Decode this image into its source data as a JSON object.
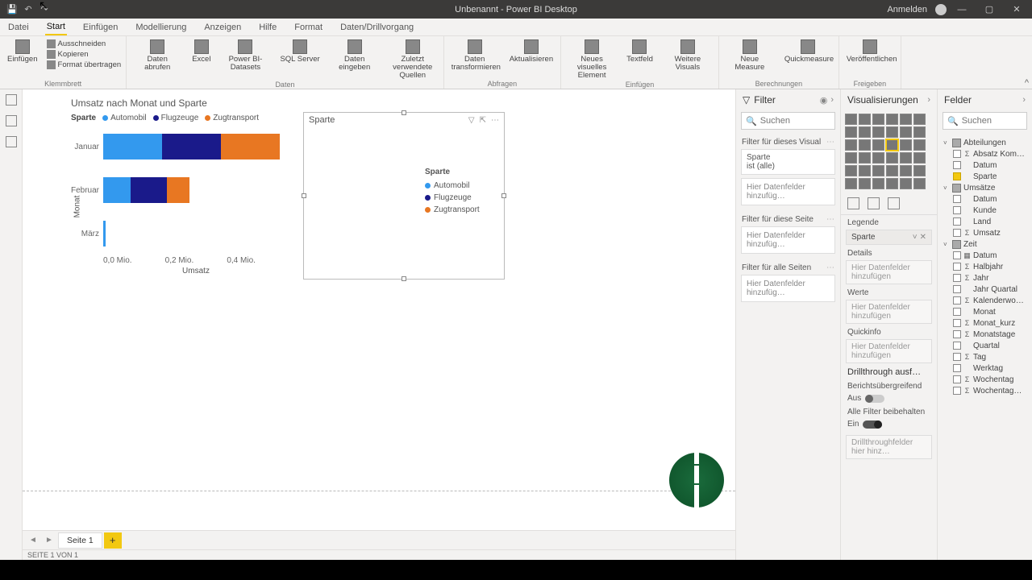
{
  "titlebar": {
    "title": "Unbenannt - Power BI Desktop",
    "signin": "Anmelden"
  },
  "ribbon": {
    "tabs": [
      "Datei",
      "Start",
      "Einfügen",
      "Modellierung",
      "Anzeigen",
      "Hilfe",
      "Format",
      "Daten/Drillvorgang"
    ],
    "active": 1,
    "groups": {
      "clipboard": {
        "label": "Klemmbrett",
        "paste": "Einfügen",
        "cut": "Ausschneiden",
        "copy": "Kopieren",
        "fmt": "Format übertragen"
      },
      "data": {
        "label": "Daten",
        "get": "Daten\nabrufen",
        "excel": "Excel",
        "pbi": "Power\nBI-Datasets",
        "sql": "SQL\nServer",
        "enter": "Daten\neingeben",
        "recent": "Zuletzt verwendete\nQuellen"
      },
      "queries": {
        "label": "Abfragen",
        "transform": "Daten\ntransformieren",
        "refresh": "Aktualisieren"
      },
      "insert": {
        "label": "Einfügen",
        "newvis": "Neues visuelles\nElement",
        "textbox": "Textfeld",
        "more": "Weitere\nVisuals"
      },
      "calc": {
        "label": "Berechnungen",
        "measure": "Neue\nMeasure",
        "quick": "Quickmeasure"
      },
      "share": {
        "label": "Freigeben",
        "publish": "Veröffentlichen"
      }
    }
  },
  "chart": {
    "title": "Umsatz nach Monat und Sparte",
    "legendName": "Sparte",
    "legend": [
      {
        "label": "Automobil",
        "color": "#3399ee"
      },
      {
        "label": "Flugzeuge",
        "color": "#1a1a8a"
      },
      {
        "label": "Zugtransport",
        "color": "#e87722"
      }
    ],
    "ylabel": "Monat",
    "xlabel": "Umsatz",
    "xticks": [
      "0,0 Mio.",
      "0,2 Mio.",
      "0,4 Mio."
    ]
  },
  "chart_data": {
    "type": "bar",
    "orientation": "horizontal-stacked",
    "title": "Umsatz nach Monat und Sparte",
    "xlabel": "Umsatz",
    "ylabel": "Monat",
    "x_unit": "Mio.",
    "xlim": [
      0,
      0.4
    ],
    "categories": [
      "Januar",
      "Februar",
      "März"
    ],
    "series": [
      {
        "name": "Automobil",
        "color": "#3399ee",
        "values": [
          0.13,
          0.06,
          0.005
        ]
      },
      {
        "name": "Flugzeuge",
        "color": "#1a1a8a",
        "values": [
          0.13,
          0.08,
          0
        ]
      },
      {
        "name": "Zugtransport",
        "color": "#e87722",
        "values": [
          0.13,
          0.05,
          0
        ]
      }
    ]
  },
  "slicer": {
    "title": "Sparte",
    "legendTitle": "Sparte",
    "items": [
      {
        "label": "Automobil",
        "color": "#3399ee"
      },
      {
        "label": "Flugzeuge",
        "color": "#1a1a8a"
      },
      {
        "label": "Zugtransport",
        "color": "#e87722"
      }
    ]
  },
  "pagetabs": {
    "page": "Seite 1"
  },
  "status": "SEITE 1 VON 1",
  "filter": {
    "title": "Filter",
    "search": "Suchen",
    "visual": "Filter für dieses Visual",
    "card": {
      "field": "Sparte",
      "state": "ist (alle)"
    },
    "add": "Hier Datenfelder hinzufüg…",
    "page": "Filter für diese Seite",
    "all": "Filter für alle Seiten"
  },
  "viz": {
    "title": "Visualisierungen",
    "legend": "Legende",
    "legSlot": "Sparte",
    "details": "Details",
    "values": "Werte",
    "tooltip": "Quickinfo",
    "addfield": "Hier Datenfelder hinzufügen",
    "drill": "Drillthrough ausf…",
    "cross": "Berichtsübergreifend",
    "off": "Aus",
    "keep": "Alle Filter beibehalten",
    "on": "Ein",
    "drilladd": "Drillthroughfelder hier hinz…"
  },
  "fields": {
    "title": "Felder",
    "search": "Suchen",
    "tables": [
      {
        "name": "Abteilungen",
        "expanded": true,
        "fields": [
          {
            "name": "Absatz Kom…",
            "sigma": true
          },
          {
            "name": "Datum"
          },
          {
            "name": "Sparte",
            "selected": true
          }
        ]
      },
      {
        "name": "Umsätze",
        "expanded": true,
        "fields": [
          {
            "name": "Datum"
          },
          {
            "name": "Kunde"
          },
          {
            "name": "Land"
          },
          {
            "name": "Umsatz",
            "sigma": true
          }
        ]
      },
      {
        "name": "Zeit",
        "expanded": true,
        "fields": [
          {
            "name": "Datum",
            "hier": true
          },
          {
            "name": "Halbjahr",
            "sigma": true
          },
          {
            "name": "Jahr",
            "sigma": true
          },
          {
            "name": "Jahr Quartal"
          },
          {
            "name": "Kalenderwo…",
            "sigma": true
          },
          {
            "name": "Monat"
          },
          {
            "name": "Monat_kurz",
            "sigma": true
          },
          {
            "name": "Monatstage",
            "sigma": true
          },
          {
            "name": "Quartal"
          },
          {
            "name": "Tag",
            "sigma": true
          },
          {
            "name": "Werktag"
          },
          {
            "name": "Wochentag",
            "sigma": true
          },
          {
            "name": "Wochentag…",
            "sigma": true
          }
        ]
      }
    ]
  }
}
